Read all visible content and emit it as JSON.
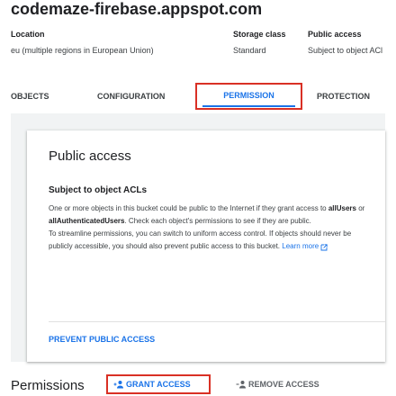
{
  "bucket": {
    "title": "codemaze-firebase.appspot.com"
  },
  "meta": {
    "headers": {
      "location": "Location",
      "storage_class": "Storage class",
      "public_access": "Public access"
    },
    "values": {
      "location": "eu (multiple regions in European Union)",
      "storage_class": "Standard",
      "public_access": "Subject to object ACl"
    }
  },
  "tabs": [
    {
      "label": "OBJECTS"
    },
    {
      "label": "CONFIGURATION"
    },
    {
      "label": "PERMISSION",
      "active": true
    },
    {
      "label": "PROTECTION"
    }
  ],
  "public_access_card": {
    "title": "Public access",
    "subtitle": "Subject to object ACLs",
    "body_1": "One or more objects in this bucket could be public to the Internet if they grant access to ",
    "all_users": "allUsers",
    "or": " or ",
    "all_auth_users": "allAuthenticatedUsers",
    "body_2": ". Check each object's permissions to see if they are public.",
    "body_3": "To streamline permissions, you can switch to uniform access control. If objects should never be publicly accessible, you should also prevent public access to this bucket.",
    "learn_more": "Learn more",
    "prevent_button": "PREVENT PUBLIC ACCESS"
  },
  "permissions": {
    "title": "Permissions",
    "grant_button": "GRANT ACCESS",
    "remove_button": "REMOVE ACCESS"
  },
  "colors": {
    "accent": "#1a73e8",
    "highlight_border": "#d93025",
    "panel_bg": "#f1f3f4"
  },
  "icons": {
    "external_link": "open-in-new-icon",
    "grant": "person-add-icon",
    "remove": "person-remove-icon"
  }
}
